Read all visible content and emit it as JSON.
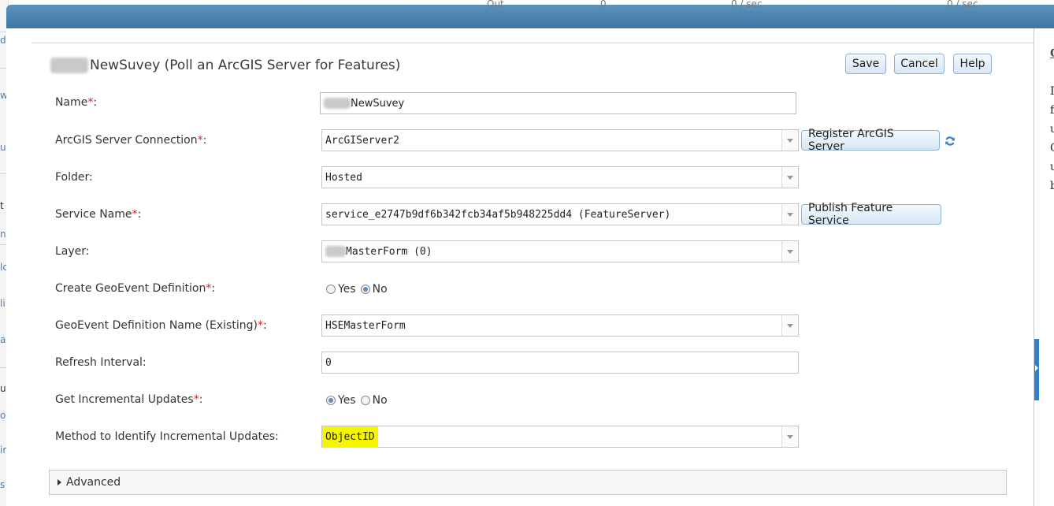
{
  "dialog": {
    "title": "NewSuvey (Poll an ArcGIS Server for Features)",
    "buttons": {
      "save": "Save",
      "cancel": "Cancel",
      "help": "Help"
    }
  },
  "background": {
    "top_fragments": [
      "Out",
      "0",
      "0 / sec",
      "0 / sec"
    ],
    "right_panel_chars": [
      "C",
      "I",
      "f",
      "u",
      "C",
      "u",
      "b"
    ]
  },
  "form": {
    "name": {
      "label": "Name",
      "value": "NewSuvey"
    },
    "connection": {
      "label": "ArcGIS Server Connection",
      "value": "ArcGIServer2",
      "action": "Register ArcGIS Server"
    },
    "folder": {
      "label": "Folder:",
      "value": "Hosted"
    },
    "service": {
      "label": "Service Name",
      "value": "service_e2747b9df6b342fcb34af5b948225dd4 (FeatureServer)",
      "action": "Publish Feature Service"
    },
    "layer": {
      "label": "Layer:",
      "value": "MasterForm (0)"
    },
    "create_geoevent": {
      "label": "Create GeoEvent Definition",
      "options": [
        "Yes",
        "No"
      ],
      "selected": "No"
    },
    "geoevent_name": {
      "label": "GeoEvent Definition Name (Existing)",
      "value": "HSEMasterForm"
    },
    "refresh": {
      "label": "Refresh Interval:",
      "value": "0"
    },
    "incremental": {
      "label": "Get Incremental Updates",
      "options": [
        "Yes",
        "No"
      ],
      "selected": "Yes"
    },
    "method": {
      "label": "Method to Identify Incremental Updates:",
      "value": "ObjectID"
    }
  },
  "advanced": {
    "label": "Advanced"
  },
  "icons": {
    "refresh": "refresh-icon",
    "caret": "caret-right-icon",
    "dropdown": "chevron-down-icon"
  },
  "colors": {
    "header": "#3f77a3",
    "required": "#d42323",
    "highlight": "#f5f500",
    "button_border": "#8fb0cf"
  }
}
